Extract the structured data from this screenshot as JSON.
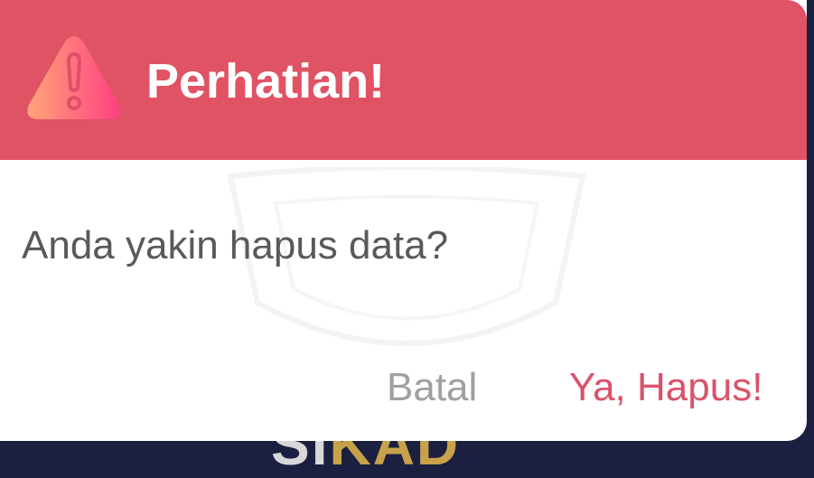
{
  "dialog": {
    "title": "Perhatian!",
    "message": "Anda yakin hapus data?",
    "icon": "warning-triangle-icon",
    "buttons": {
      "cancel_label": "Batal",
      "confirm_label": "Ya, Hapus!"
    }
  },
  "background": {
    "partial_text_prefix": "SI",
    "partial_text_accent": "KAD"
  },
  "colors": {
    "header": "#e05364",
    "title_text": "#ffffff",
    "message_text": "#595959",
    "cancel_text": "#a0a0a0",
    "confirm_text": "#d9536a",
    "backdrop": "#1c2040",
    "icon_gradient_start": "#ffa57a",
    "icon_gradient_end": "#ff3f80"
  }
}
